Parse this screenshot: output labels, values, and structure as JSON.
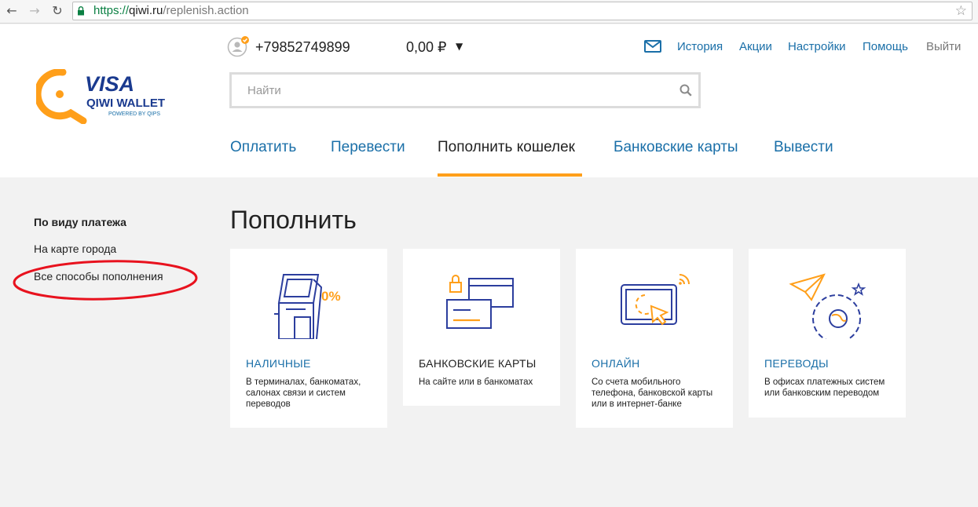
{
  "browser": {
    "url_protocol": "https://",
    "url_host": "qiwi.ru",
    "url_path": "/replenish.action"
  },
  "header": {
    "logo": {
      "visa": "VISA",
      "wallet": "QIWI WALLET",
      "powered": "POWERED BY QIPS"
    },
    "phone": "+79852749899",
    "balance": "0,00 ₽",
    "links": {
      "history": "История",
      "promos": "Акции",
      "settings": "Настройки",
      "help": "Помощь",
      "logout": "Выйти"
    },
    "search": {
      "placeholder": "Найти"
    },
    "tabs": {
      "pay": "Оплатить",
      "transfer": "Перевести",
      "replenish": "Пополнить кошелек",
      "cards": "Банковские карты",
      "withdraw": "Вывести"
    },
    "active_tab": "replenish"
  },
  "sidebar": {
    "title": "По виду платежа",
    "items": [
      "На карте города",
      "Все способы пополнения"
    ]
  },
  "main": {
    "heading": "Пополнить",
    "cards": [
      {
        "title": "НАЛИЧНЫЕ",
        "desc": "В терминалах, банкоматах, салонах связи и систем переводов",
        "icon": "terminal-icon",
        "badge": "0%"
      },
      {
        "title": "БАНКОВСКИЕ КАРТЫ",
        "desc": "На сайте или в банкоматах",
        "icon": "bank-cards-icon"
      },
      {
        "title": "ОНЛАЙН",
        "desc": "Со счета мобильного телефона, банковской карты или в интернет-банке",
        "icon": "online-icon"
      },
      {
        "title": "ПЕРЕВОДЫ",
        "desc": "В офисах платежных систем или банковским переводом",
        "icon": "transfers-icon"
      }
    ]
  },
  "colors": {
    "link": "#1a6fa8",
    "accent": "#ff9f1a",
    "icon_blue": "#2c3e9e",
    "annotation": "#e8121e",
    "background": "#f2f2f2"
  }
}
